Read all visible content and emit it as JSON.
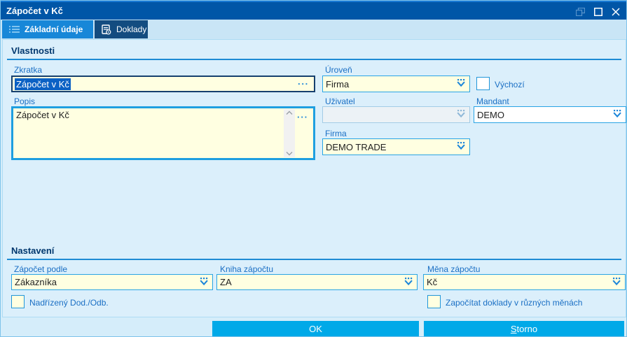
{
  "window": {
    "title": "Zápočet v Kč"
  },
  "tabs": [
    {
      "label": "Základní údaje",
      "icon": "list-icon",
      "active": true
    },
    {
      "label": "Doklady",
      "icon": "documents-icon",
      "active": false
    }
  ],
  "icons": {
    "ellipsis": "···"
  },
  "vlastnosti": {
    "title": "Vlastnosti",
    "zkratka": {
      "label": "Zkratka",
      "value": "Zápočet v Kč"
    },
    "uroven": {
      "label": "Úroveň",
      "value": "Firma"
    },
    "vychozi": {
      "label": "Výchozí",
      "checked": false
    },
    "popis": {
      "label": "Popis",
      "value": "Zápočet v Kč"
    },
    "uzivatel": {
      "label": "Uživatel",
      "value": ""
    },
    "mandant": {
      "label": "Mandant",
      "value": "DEMO"
    },
    "firma": {
      "label": "Firma",
      "value": "DEMO TRADE"
    }
  },
  "nastaveni": {
    "title": "Nastavení",
    "zapocet_podle": {
      "label": "Zápočet podle",
      "value": "Zákazníka"
    },
    "kniha_zapoctu": {
      "label": "Kniha zápočtu",
      "value": "ZA"
    },
    "mena_zapoctu": {
      "label": "Měna zápočtu",
      "value": "Kč"
    },
    "nadrizeny": {
      "label": "Nadřízený Dod./Odb.",
      "checked": false
    },
    "zapocitat": {
      "label": "Započítat doklady v různých měnách",
      "checked": false
    }
  },
  "buttons": {
    "ok": "OK",
    "storno_accel": "S",
    "storno_rest": "torno"
  },
  "colors": {
    "titlebar": "#0056A7",
    "tab_active": "#1787D8",
    "tab_inactive": "#134C80",
    "accent": "#1C86D9",
    "field_bg": "#FFFFE1",
    "button": "#00A9E8",
    "body": "#D5EDFA"
  }
}
